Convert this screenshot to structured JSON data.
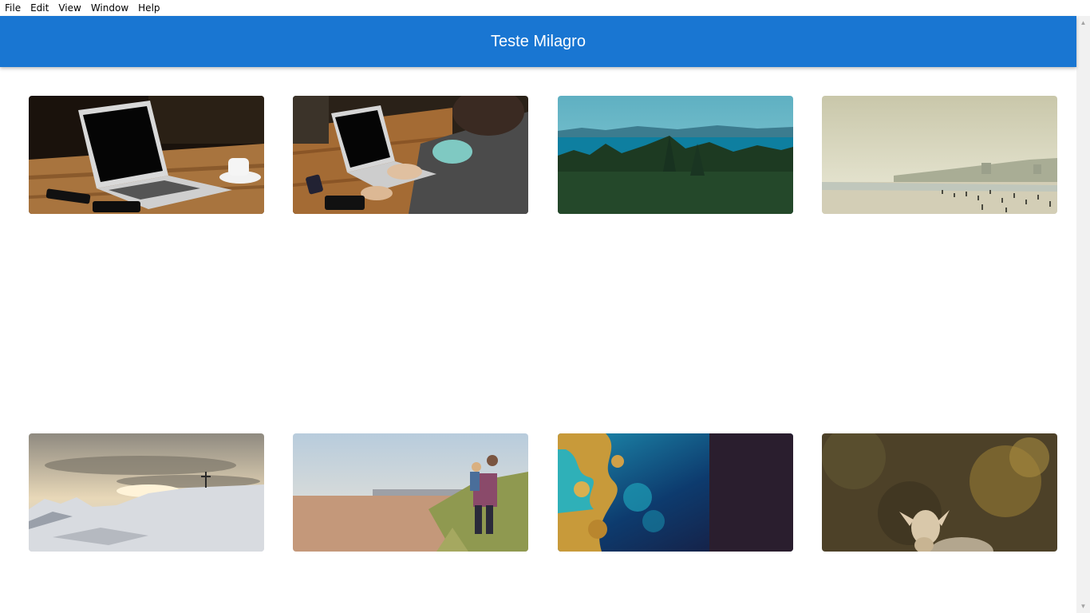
{
  "menubar": {
    "items": [
      "File",
      "Edit",
      "View",
      "Window",
      "Help"
    ]
  },
  "header": {
    "title": "Teste Milagro",
    "background": "#1976d2"
  },
  "gallery": {
    "images": [
      {
        "subject": "laptop-on-wooden-table-with-coffee-cup"
      },
      {
        "subject": "person-typing-on-laptop-at-wooden-table"
      },
      {
        "subject": "forest-and-sea-landscape"
      },
      {
        "subject": "hazy-beach-with-crowd"
      },
      {
        "subject": "snowy-mountain-with-cross-at-sunset"
      },
      {
        "subject": "man-carrying-child-on-beach-dunes"
      },
      {
        "subject": "satellite-view-of-ocean-and-coast"
      },
      {
        "subject": "fawn-in-blurred-forest"
      }
    ]
  }
}
